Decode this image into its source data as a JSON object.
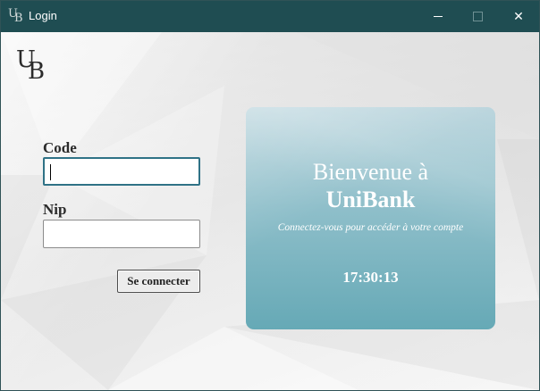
{
  "window": {
    "title": "Login",
    "title_icon": "unibank-logo-icon",
    "controls": {
      "minimize": "minimize-icon",
      "maximize": "maximize-icon",
      "close_glyph": "✕"
    }
  },
  "logo": {
    "letters": [
      "U",
      "B"
    ]
  },
  "form": {
    "code_label": "Code",
    "code_value": "",
    "nip_label": "Nip",
    "nip_value": "",
    "submit_label": "Se connecter"
  },
  "card": {
    "welcome": "Bienvenue à",
    "bank_name": "UniBank",
    "subtitle": "Connectez-vous pour accéder à votre compte",
    "time": "17:30:13"
  },
  "colors": {
    "titlebar": "#1f4d52",
    "card_top": "#bcd6de",
    "card_bottom": "#66a9b6",
    "focus_border": "#2f7286"
  }
}
